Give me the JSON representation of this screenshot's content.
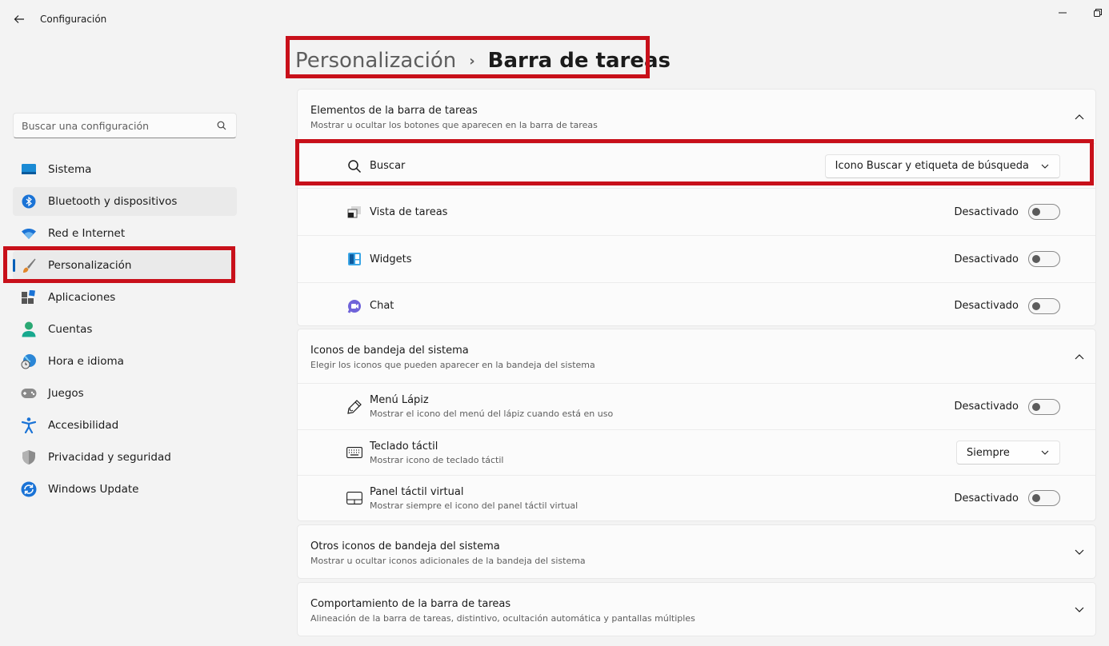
{
  "app": {
    "title": "Configuración"
  },
  "search": {
    "placeholder": "Buscar una configuración"
  },
  "sidebar": {
    "items": [
      {
        "label": "Sistema",
        "icon": "system-icon"
      },
      {
        "label": "Bluetooth y dispositivos",
        "icon": "bluetooth-icon"
      },
      {
        "label": "Red e Internet",
        "icon": "wifi-icon"
      },
      {
        "label": "Personalización",
        "icon": "brush-icon"
      },
      {
        "label": "Aplicaciones",
        "icon": "apps-icon"
      },
      {
        "label": "Cuentas",
        "icon": "account-icon"
      },
      {
        "label": "Hora e idioma",
        "icon": "globe-clock-icon"
      },
      {
        "label": "Juegos",
        "icon": "gamepad-icon"
      },
      {
        "label": "Accesibilidad",
        "icon": "accessibility-icon"
      },
      {
        "label": "Privacidad y seguridad",
        "icon": "shield-icon"
      },
      {
        "label": "Windows Update",
        "icon": "update-icon"
      }
    ]
  },
  "breadcrumb": {
    "parent": "Personalización",
    "separator": "›",
    "current": "Barra de tareas"
  },
  "sections": {
    "taskbar_items": {
      "title": "Elementos de la barra de tareas",
      "subtitle": "Mostrar u ocultar los botones que aparecen en la barra de tareas",
      "rows": {
        "search": {
          "label": "Buscar",
          "value": "Icono Buscar y etiqueta de búsqueda"
        },
        "task_view": {
          "label": "Vista de tareas",
          "state": "Desactivado"
        },
        "widgets": {
          "label": "Widgets",
          "state": "Desactivado"
        },
        "chat": {
          "label": "Chat",
          "state": "Desactivado"
        }
      }
    },
    "tray_icons": {
      "title": "Iconos de bandeja del sistema",
      "subtitle": "Elegir los iconos que pueden aparecer en la bandeja del sistema",
      "rows": {
        "pen_menu": {
          "label": "Menú Lápiz",
          "sub": "Mostrar el icono del menú del lápiz cuando está en uso",
          "state": "Desactivado"
        },
        "touch_keyboard": {
          "label": "Teclado táctil",
          "sub": "Mostrar icono de teclado táctil",
          "value": "Siempre"
        },
        "virtual_touchpad": {
          "label": "Panel táctil virtual",
          "sub": "Mostrar siempre el icono del panel táctil virtual",
          "state": "Desactivado"
        }
      }
    },
    "other_tray": {
      "title": "Otros iconos de bandeja del sistema",
      "subtitle": "Mostrar u ocultar iconos adicionales de la bandeja del sistema"
    },
    "behaviors": {
      "title": "Comportamiento de la barra de tareas",
      "subtitle": "Alineación de la barra de tareas, distintivo, ocultación automática y pantallas múltiples"
    }
  },
  "colors": {
    "accent": "#005fb8",
    "highlight": "#c8101a"
  }
}
